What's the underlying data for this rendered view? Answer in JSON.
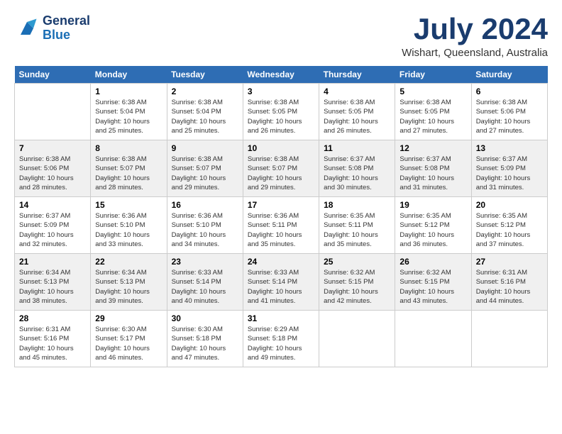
{
  "header": {
    "logo_general": "General",
    "logo_blue": "Blue",
    "month_title": "July 2024",
    "location": "Wishart, Queensland, Australia"
  },
  "days_of_week": [
    "Sunday",
    "Monday",
    "Tuesday",
    "Wednesday",
    "Thursday",
    "Friday",
    "Saturday"
  ],
  "weeks": [
    [
      {
        "day": "",
        "info": ""
      },
      {
        "day": "1",
        "info": "Sunrise: 6:38 AM\nSunset: 5:04 PM\nDaylight: 10 hours\nand 25 minutes."
      },
      {
        "day": "2",
        "info": "Sunrise: 6:38 AM\nSunset: 5:04 PM\nDaylight: 10 hours\nand 25 minutes."
      },
      {
        "day": "3",
        "info": "Sunrise: 6:38 AM\nSunset: 5:05 PM\nDaylight: 10 hours\nand 26 minutes."
      },
      {
        "day": "4",
        "info": "Sunrise: 6:38 AM\nSunset: 5:05 PM\nDaylight: 10 hours\nand 26 minutes."
      },
      {
        "day": "5",
        "info": "Sunrise: 6:38 AM\nSunset: 5:05 PM\nDaylight: 10 hours\nand 27 minutes."
      },
      {
        "day": "6",
        "info": "Sunrise: 6:38 AM\nSunset: 5:06 PM\nDaylight: 10 hours\nand 27 minutes."
      }
    ],
    [
      {
        "day": "7",
        "info": "Sunrise: 6:38 AM\nSunset: 5:06 PM\nDaylight: 10 hours\nand 28 minutes."
      },
      {
        "day": "8",
        "info": "Sunrise: 6:38 AM\nSunset: 5:07 PM\nDaylight: 10 hours\nand 28 minutes."
      },
      {
        "day": "9",
        "info": "Sunrise: 6:38 AM\nSunset: 5:07 PM\nDaylight: 10 hours\nand 29 minutes."
      },
      {
        "day": "10",
        "info": "Sunrise: 6:38 AM\nSunset: 5:07 PM\nDaylight: 10 hours\nand 29 minutes."
      },
      {
        "day": "11",
        "info": "Sunrise: 6:37 AM\nSunset: 5:08 PM\nDaylight: 10 hours\nand 30 minutes."
      },
      {
        "day": "12",
        "info": "Sunrise: 6:37 AM\nSunset: 5:08 PM\nDaylight: 10 hours\nand 31 minutes."
      },
      {
        "day": "13",
        "info": "Sunrise: 6:37 AM\nSunset: 5:09 PM\nDaylight: 10 hours\nand 31 minutes."
      }
    ],
    [
      {
        "day": "14",
        "info": "Sunrise: 6:37 AM\nSunset: 5:09 PM\nDaylight: 10 hours\nand 32 minutes."
      },
      {
        "day": "15",
        "info": "Sunrise: 6:36 AM\nSunset: 5:10 PM\nDaylight: 10 hours\nand 33 minutes."
      },
      {
        "day": "16",
        "info": "Sunrise: 6:36 AM\nSunset: 5:10 PM\nDaylight: 10 hours\nand 34 minutes."
      },
      {
        "day": "17",
        "info": "Sunrise: 6:36 AM\nSunset: 5:11 PM\nDaylight: 10 hours\nand 35 minutes."
      },
      {
        "day": "18",
        "info": "Sunrise: 6:35 AM\nSunset: 5:11 PM\nDaylight: 10 hours\nand 35 minutes."
      },
      {
        "day": "19",
        "info": "Sunrise: 6:35 AM\nSunset: 5:12 PM\nDaylight: 10 hours\nand 36 minutes."
      },
      {
        "day": "20",
        "info": "Sunrise: 6:35 AM\nSunset: 5:12 PM\nDaylight: 10 hours\nand 37 minutes."
      }
    ],
    [
      {
        "day": "21",
        "info": "Sunrise: 6:34 AM\nSunset: 5:13 PM\nDaylight: 10 hours\nand 38 minutes."
      },
      {
        "day": "22",
        "info": "Sunrise: 6:34 AM\nSunset: 5:13 PM\nDaylight: 10 hours\nand 39 minutes."
      },
      {
        "day": "23",
        "info": "Sunrise: 6:33 AM\nSunset: 5:14 PM\nDaylight: 10 hours\nand 40 minutes."
      },
      {
        "day": "24",
        "info": "Sunrise: 6:33 AM\nSunset: 5:14 PM\nDaylight: 10 hours\nand 41 minutes."
      },
      {
        "day": "25",
        "info": "Sunrise: 6:32 AM\nSunset: 5:15 PM\nDaylight: 10 hours\nand 42 minutes."
      },
      {
        "day": "26",
        "info": "Sunrise: 6:32 AM\nSunset: 5:15 PM\nDaylight: 10 hours\nand 43 minutes."
      },
      {
        "day": "27",
        "info": "Sunrise: 6:31 AM\nSunset: 5:16 PM\nDaylight: 10 hours\nand 44 minutes."
      }
    ],
    [
      {
        "day": "28",
        "info": "Sunrise: 6:31 AM\nSunset: 5:16 PM\nDaylight: 10 hours\nand 45 minutes."
      },
      {
        "day": "29",
        "info": "Sunrise: 6:30 AM\nSunset: 5:17 PM\nDaylight: 10 hours\nand 46 minutes."
      },
      {
        "day": "30",
        "info": "Sunrise: 6:30 AM\nSunset: 5:18 PM\nDaylight: 10 hours\nand 47 minutes."
      },
      {
        "day": "31",
        "info": "Sunrise: 6:29 AM\nSunset: 5:18 PM\nDaylight: 10 hours\nand 49 minutes."
      },
      {
        "day": "",
        "info": ""
      },
      {
        "day": "",
        "info": ""
      },
      {
        "day": "",
        "info": ""
      }
    ]
  ]
}
